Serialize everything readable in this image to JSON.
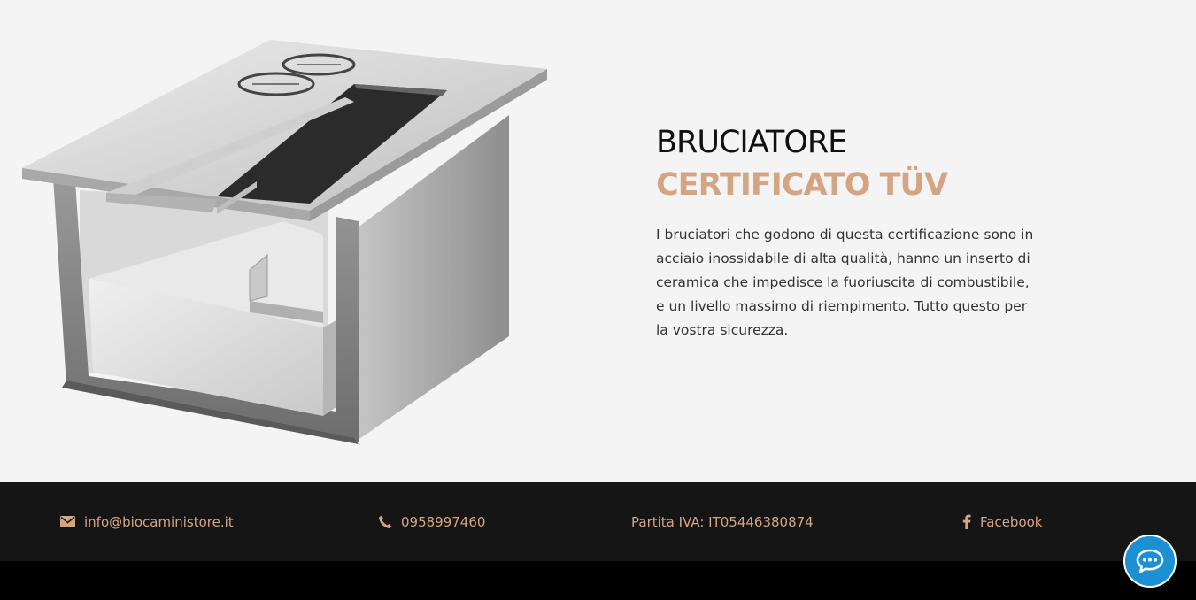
{
  "hero": {
    "title_line1": "BRUCIATORE",
    "title_line2": "CERTIFICATO TÜV",
    "description": "I bruciatori che godono di questa certificazione sono in acciaio inossidabile di alta qualità, hanno un inserto di ceramica che impedisce la fuoriuscita di combustibile, e un livello massimo di riempimento. Tutto questo per la vostra sicurezza.",
    "image_icon": "stainless-steel-burner-image",
    "accent_color": "#d4a583"
  },
  "footer": {
    "email": "info@biocaministore.it",
    "email_icon": "envelope-icon",
    "phone": "0958997460",
    "phone_icon": "phone-icon",
    "vat": "Partita IVA: IT05446380874",
    "facebook": "Facebook",
    "facebook_icon": "facebook-icon",
    "background_color": "#151515"
  },
  "chat": {
    "icon": "chat-bubble-icon",
    "color": "#1d8fd3"
  }
}
